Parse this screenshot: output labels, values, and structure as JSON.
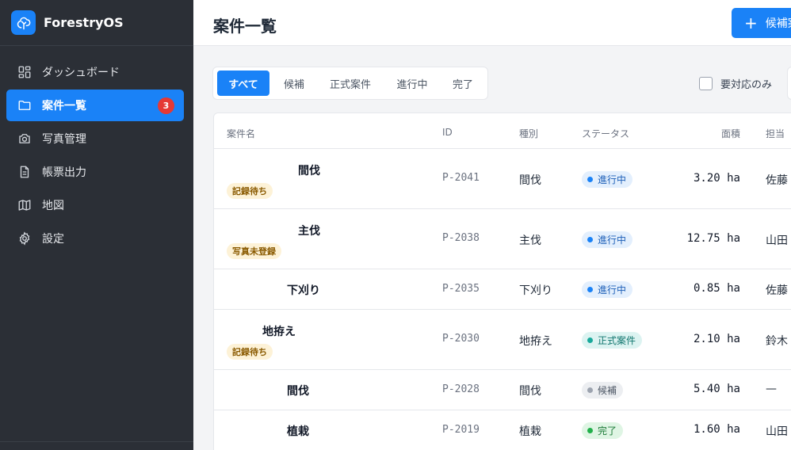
{
  "app": {
    "name": "ForestryOS"
  },
  "sidebar": {
    "items": [
      {
        "label": "ダッシュボード",
        "icon": "dashboard-icon"
      },
      {
        "label": "案件一覧",
        "icon": "folder-icon",
        "badge": "3",
        "active": true
      },
      {
        "label": "写真管理",
        "icon": "camera-icon"
      },
      {
        "label": "帳票出力",
        "icon": "document-icon"
      },
      {
        "label": "地図",
        "icon": "map-icon"
      },
      {
        "label": "設定",
        "icon": "gear-icon"
      }
    ]
  },
  "header": {
    "title": "案件一覧",
    "add_button_label": "候補案"
  },
  "filters": {
    "tabs": [
      "すべて",
      "候補",
      "正式案件",
      "進行中",
      "完了"
    ],
    "active_tab": "すべて",
    "only_action_label": "要対応のみ"
  },
  "table": {
    "columns": {
      "name": "案件名",
      "id": "ID",
      "type": "種別",
      "status": "ステータス",
      "area": "面積",
      "owner": "担当"
    },
    "rows": [
      {
        "name": "間伐",
        "tag": "記録待ち",
        "id": "P-2041",
        "type": "間伐",
        "status": "進行中",
        "area": "3.20 ha",
        "owner": "佐藤"
      },
      {
        "name": "主伐",
        "tag": "写真未登録",
        "id": "P-2038",
        "type": "主伐",
        "status": "進行中",
        "area": "12.75 ha",
        "owner": "山田"
      },
      {
        "name": "下刈り",
        "tag": "",
        "id": "P-2035",
        "type": "下刈り",
        "status": "進行中",
        "area": "0.85 ha",
        "owner": "佐藤"
      },
      {
        "name": "地拵え",
        "tag": "記録待ち",
        "id": "P-2030",
        "type": "地拵え",
        "status": "正式案件",
        "area": "2.10 ha",
        "owner": "鈴木"
      },
      {
        "name": "間伐",
        "tag": "",
        "id": "P-2028",
        "type": "間伐",
        "status": "候補",
        "area": "5.40 ha",
        "owner": "—"
      },
      {
        "name": "植栽",
        "tag": "",
        "id": "P-2019",
        "type": "植栽",
        "status": "完了",
        "area": "1.60 ha",
        "owner": "山田"
      }
    ]
  },
  "status_colors": {
    "進行中": {
      "bg": "#e3effd",
      "fg": "#1d5fb8",
      "dot": "#1a82f7"
    },
    "正式案件": {
      "bg": "#dcf3f1",
      "fg": "#11766e",
      "dot": "#19a99b"
    },
    "候補": {
      "bg": "#eceef1",
      "fg": "#4b5563",
      "dot": "#9ca3af"
    },
    "完了": {
      "bg": "#dff5e4",
      "fg": "#1b7a36",
      "dot": "#22b04b"
    }
  },
  "colors": {
    "accent": "#1a82f7",
    "sidebar_bg": "#2b2f36",
    "badge": "#e53935"
  }
}
